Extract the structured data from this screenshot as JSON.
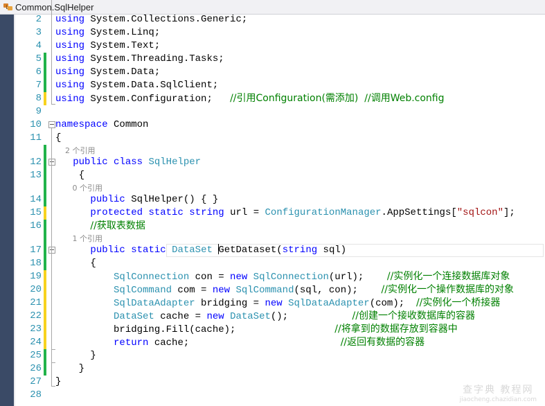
{
  "navigation_bar": {
    "icon": "class-icon",
    "title": "Common.SqlHelper"
  },
  "editor": {
    "lines": [
      {
        "n": "2",
        "change": "",
        "tokens": [
          {
            "k": "kw",
            "t": "using"
          },
          {
            "k": "",
            "t": " System.Collections.Generic;"
          }
        ]
      },
      {
        "n": "3",
        "change": "",
        "tokens": [
          {
            "k": "kw",
            "t": "using"
          },
          {
            "k": "",
            "t": " System.Linq;"
          }
        ]
      },
      {
        "n": "4",
        "change": "",
        "tokens": [
          {
            "k": "kw",
            "t": "using"
          },
          {
            "k": "",
            "t": " System.Text;"
          }
        ]
      },
      {
        "n": "5",
        "change": "saved",
        "tokens": [
          {
            "k": "kw",
            "t": "using"
          },
          {
            "k": "",
            "t": " System.Threading.Tasks;"
          }
        ]
      },
      {
        "n": "6",
        "change": "saved",
        "tokens": [
          {
            "k": "kw",
            "t": "using"
          },
          {
            "k": "",
            "t": " System.Data;"
          }
        ]
      },
      {
        "n": "7",
        "change": "saved",
        "tokens": [
          {
            "k": "kw",
            "t": "using"
          },
          {
            "k": "",
            "t": " System.Data.SqlClient;"
          }
        ]
      },
      {
        "n": "8",
        "change": "unsaved",
        "tokens": [
          {
            "k": "kw",
            "t": "using"
          },
          {
            "k": "",
            "t": " System.Configuration;   "
          },
          {
            "k": "cm",
            "t": "//引用Configuration(需添加)  //调用Web.config"
          }
        ]
      },
      {
        "n": "9",
        "change": "",
        "tokens": []
      },
      {
        "n": "10",
        "change": "",
        "fold": true,
        "tokens": [
          {
            "k": "kw",
            "t": "namespace"
          },
          {
            "k": "",
            "t": " Common"
          }
        ]
      },
      {
        "n": "11",
        "change": "",
        "tokens": [
          {
            "k": "",
            "t": "{"
          }
        ]
      },
      {
        "n": "12",
        "change": "saved",
        "fold": true,
        "lens": "    2 个引用",
        "tokens": [
          {
            "k": "",
            "t": "   "
          },
          {
            "k": "kw",
            "t": "public"
          },
          {
            "k": "",
            "t": " "
          },
          {
            "k": "kw",
            "t": "class"
          },
          {
            "k": "",
            "t": " "
          },
          {
            "k": "ty",
            "t": "SqlHelper"
          }
        ]
      },
      {
        "n": "13",
        "change": "saved",
        "tokens": [
          {
            "k": "",
            "t": "    {"
          }
        ]
      },
      {
        "n": "14",
        "change": "saved",
        "lens": "       0 个引用",
        "tokens": [
          {
            "k": "",
            "t": "      "
          },
          {
            "k": "kw",
            "t": "public"
          },
          {
            "k": "",
            "t": " SqlHelper() { }"
          }
        ]
      },
      {
        "n": "15",
        "change": "unsaved",
        "tokens": [
          {
            "k": "",
            "t": "      "
          },
          {
            "k": "kw",
            "t": "protected"
          },
          {
            "k": "",
            "t": " "
          },
          {
            "k": "kw",
            "t": "static"
          },
          {
            "k": "",
            "t": " "
          },
          {
            "k": "kw",
            "t": "string"
          },
          {
            "k": "",
            "t": " url = "
          },
          {
            "k": "ty",
            "t": "ConfigurationManager"
          },
          {
            "k": "",
            "t": ".AppSettings["
          },
          {
            "k": "str",
            "t": "\"sqlcon\""
          },
          {
            "k": "",
            "t": "];"
          }
        ]
      },
      {
        "n": "16",
        "change": "saved",
        "tokens": [
          {
            "k": "",
            "t": "      "
          },
          {
            "k": "cm",
            "t": "//获取表数据"
          }
        ]
      },
      {
        "n": "17",
        "change": "saved",
        "fold": true,
        "current": true,
        "lens": "       1 个引用",
        "tokens": [
          {
            "k": "",
            "t": "      "
          },
          {
            "k": "kw",
            "t": "public"
          },
          {
            "k": "",
            "t": " "
          },
          {
            "k": "kw",
            "t": "static"
          },
          {
            "k": "",
            "t": " "
          },
          {
            "k": "ty",
            "t": "DataSet"
          },
          {
            "k": "",
            "t": " "
          },
          {
            "k": "caret",
            "t": ""
          },
          {
            "k": "",
            "t": "GetDataset("
          },
          {
            "k": "kw",
            "t": "string"
          },
          {
            "k": "",
            "t": " sql)"
          }
        ]
      },
      {
        "n": "18",
        "change": "saved",
        "tokens": [
          {
            "k": "",
            "t": "      {"
          }
        ]
      },
      {
        "n": "19",
        "change": "unsaved",
        "tokens": [
          {
            "k": "",
            "t": "          "
          },
          {
            "k": "ty",
            "t": "SqlConnection"
          },
          {
            "k": "",
            "t": " con = "
          },
          {
            "k": "kw",
            "t": "new"
          },
          {
            "k": "",
            "t": " "
          },
          {
            "k": "ty",
            "t": "SqlConnection"
          },
          {
            "k": "",
            "t": "(url);    "
          },
          {
            "k": "cm",
            "t": "//实例化一个连接数据库对象"
          }
        ]
      },
      {
        "n": "20",
        "change": "unsaved",
        "tokens": [
          {
            "k": "",
            "t": "          "
          },
          {
            "k": "ty",
            "t": "SqlCommand"
          },
          {
            "k": "",
            "t": " com = "
          },
          {
            "k": "kw",
            "t": "new"
          },
          {
            "k": "",
            "t": " "
          },
          {
            "k": "ty",
            "t": "SqlCommand"
          },
          {
            "k": "",
            "t": "(sql, con);    "
          },
          {
            "k": "cm",
            "t": "//实例化一个操作数据库的对象"
          }
        ]
      },
      {
        "n": "21",
        "change": "unsaved",
        "tokens": [
          {
            "k": "",
            "t": "          "
          },
          {
            "k": "ty",
            "t": "SqlDataAdapter"
          },
          {
            "k": "",
            "t": " bridging = "
          },
          {
            "k": "kw",
            "t": "new"
          },
          {
            "k": "",
            "t": " "
          },
          {
            "k": "ty",
            "t": "SqlDataAdapter"
          },
          {
            "k": "",
            "t": "(com);  "
          },
          {
            "k": "cm",
            "t": "//实例化一个桥接器"
          }
        ]
      },
      {
        "n": "22",
        "change": "unsaved",
        "tokens": [
          {
            "k": "",
            "t": "          "
          },
          {
            "k": "ty",
            "t": "DataSet"
          },
          {
            "k": "",
            "t": " cache = "
          },
          {
            "k": "kw",
            "t": "new"
          },
          {
            "k": "",
            "t": " "
          },
          {
            "k": "ty",
            "t": "DataSet"
          },
          {
            "k": "",
            "t": "();           "
          },
          {
            "k": "cm",
            "t": "//创建一个接收数据库的容器"
          }
        ]
      },
      {
        "n": "23",
        "change": "unsaved",
        "tokens": [
          {
            "k": "",
            "t": "          bridging.Fill(cache);                 "
          },
          {
            "k": "cm",
            "t": "//将拿到的数据存放到容器中"
          }
        ]
      },
      {
        "n": "24",
        "change": "unsaved",
        "tokens": [
          {
            "k": "",
            "t": "          "
          },
          {
            "k": "kw",
            "t": "return"
          },
          {
            "k": "",
            "t": " cache;                          "
          },
          {
            "k": "cm",
            "t": "//返回有数据的容器"
          }
        ]
      },
      {
        "n": "25",
        "change": "saved",
        "tokens": [
          {
            "k": "",
            "t": "      }"
          }
        ]
      },
      {
        "n": "26",
        "change": "saved",
        "tokens": [
          {
            "k": "",
            "t": "    }"
          }
        ]
      },
      {
        "n": "27",
        "change": "",
        "tokens": [
          {
            "k": "",
            "t": "}"
          }
        ]
      },
      {
        "n": "28",
        "change": "",
        "tokens": []
      }
    ]
  },
  "colors": {
    "saved_change": "#21b34a",
    "unsaved_change": "#f7d21e",
    "keyword": "#0000ff",
    "type": "#2b91af",
    "comment": "#008000",
    "string": "#a31515",
    "line_number": "#2b91af"
  },
  "watermark": {
    "line1": "查字典 教程网",
    "line2": "jiaocheng.chazidian.com"
  }
}
